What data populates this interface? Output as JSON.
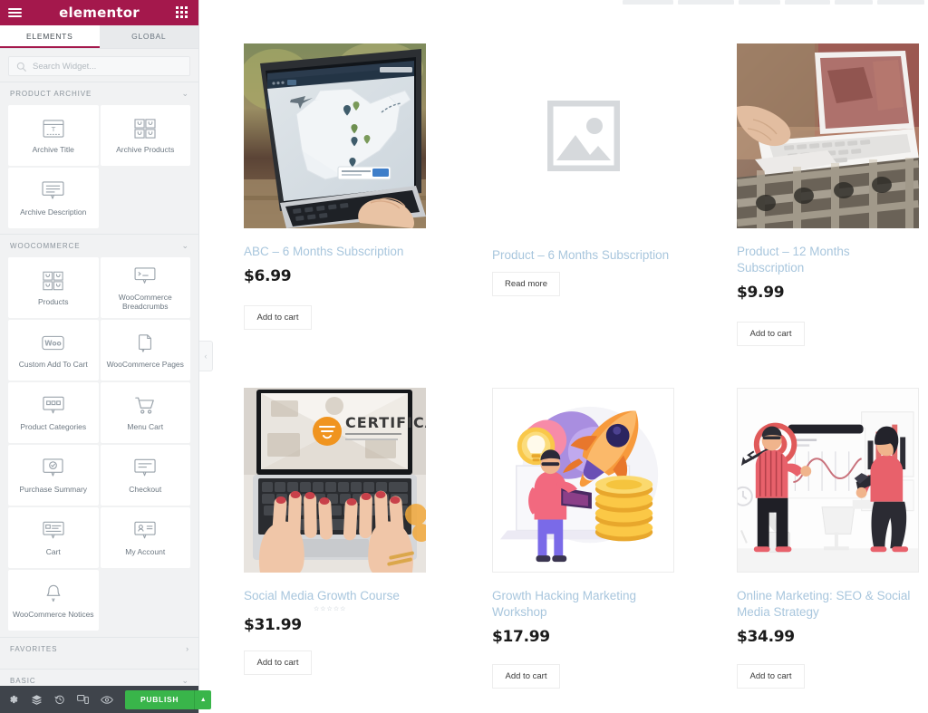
{
  "panel": {
    "brand": "elementor",
    "menu_icon": "hamburger-icon",
    "apps_icon": "grid-apps-icon",
    "tabs": [
      {
        "label": "ELEMENTS",
        "active": true
      },
      {
        "label": "GLOBAL",
        "active": false
      }
    ],
    "search": {
      "placeholder": "Search Widget...",
      "value": "",
      "icon": "search-icon"
    },
    "categories": [
      {
        "id": "product-archive",
        "label": "PRODUCT ARCHIVE",
        "chevron": "⌄",
        "expanded": true,
        "widgets": [
          {
            "label": "Archive Title",
            "icon": "archive-title-icon"
          },
          {
            "label": "Archive Products",
            "icon": "archive-products-icon"
          },
          {
            "label": "Archive Description",
            "icon": "archive-description-icon"
          }
        ]
      },
      {
        "id": "woocommerce",
        "label": "WOOCOMMERCE",
        "chevron": "⌄",
        "expanded": true,
        "widgets": [
          {
            "label": "Products",
            "icon": "products-icon"
          },
          {
            "label": "WooCommerce Breadcrumbs",
            "icon": "breadcrumbs-icon"
          },
          {
            "label": "Custom Add To Cart",
            "icon": "woo-add-to-cart-icon"
          },
          {
            "label": "WooCommerce Pages",
            "icon": "woo-pages-icon"
          },
          {
            "label": "Product Categories",
            "icon": "product-categories-icon"
          },
          {
            "label": "Menu Cart",
            "icon": "menu-cart-icon"
          },
          {
            "label": "Purchase Summary",
            "icon": "purchase-summary-icon"
          },
          {
            "label": "Checkout",
            "icon": "checkout-icon"
          },
          {
            "label": "Cart",
            "icon": "cart-icon"
          },
          {
            "label": "My Account",
            "icon": "my-account-icon"
          },
          {
            "label": "WooCommerce Notices",
            "icon": "notices-bell-icon"
          }
        ]
      },
      {
        "id": "favorites",
        "label": "FAVORITES",
        "chevron": "›",
        "expanded": false,
        "widgets": []
      },
      {
        "id": "basic",
        "label": "BASIC",
        "chevron": "⌄",
        "expanded": false,
        "widgets": []
      }
    ],
    "footer": {
      "icons": [
        {
          "name": "settings-gear-icon",
          "title": "Settings"
        },
        {
          "name": "navigator-layers-icon",
          "title": "Navigator"
        },
        {
          "name": "history-revisions-icon",
          "title": "History"
        },
        {
          "name": "responsive-mode-icon",
          "title": "Responsive Mode"
        },
        {
          "name": "preview-eye-icon",
          "title": "Preview Changes"
        }
      ],
      "publish_label": "PUBLISH",
      "publish_caret": "▲",
      "publish_color": "#39b54a"
    },
    "collapse_handle": "‹"
  },
  "canvas": {
    "products": [
      {
        "title": "ABC – 6 Months Subscription",
        "price": "$6.99",
        "button": "Add to cart",
        "image": "laptop-map-photo",
        "framed": false,
        "rating": null
      },
      {
        "title": "Product – 6 Months Subscription",
        "price": "",
        "button": "Read more",
        "image": "placeholder-image-icon",
        "framed": false,
        "rating": null
      },
      {
        "title": "Product – 12 Months Subscription",
        "price": "$9.99",
        "button": "Add to cart",
        "image": "laptop-lap-photo",
        "framed": false,
        "rating": null
      },
      {
        "title": "Social Media Growth Course",
        "price": "$31.99",
        "button": "Add to cart",
        "image": "certification-laptop-photo",
        "framed": false,
        "rating": "☆☆☆☆☆"
      },
      {
        "title": "Growth Hacking Marketing Workshop",
        "price": "$17.99",
        "button": "Add to cart",
        "image": "rocket-growth-illustration",
        "framed": true,
        "rating": null
      },
      {
        "title": "Online Marketing: SEO & Social Media Strategy",
        "price": "$34.99",
        "button": "Add to cart",
        "image": "presentation-chart-illustration",
        "framed": true,
        "rating": null
      }
    ]
  },
  "colors": {
    "brand_header": "#a4184c",
    "publish_green": "#39b54a",
    "panel_bg": "#f1f2f3",
    "footer_bg": "#3f444b",
    "link_blue": "#a8c6dd"
  }
}
